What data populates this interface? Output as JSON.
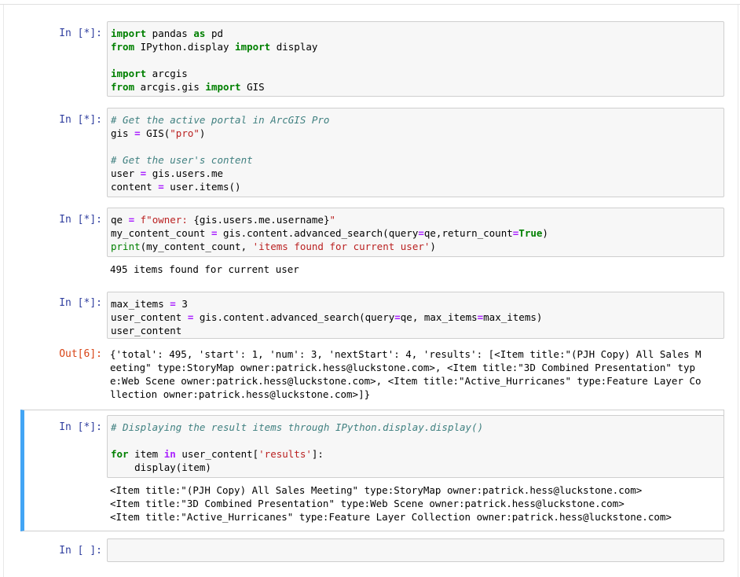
{
  "cells": [
    {
      "prompt": "In [*]:",
      "lines": [
        "import pandas as pd",
        "from IPython.display import display",
        "",
        "import arcgis",
        "from arcgis.gis import GIS"
      ]
    },
    {
      "prompt": "In [*]:",
      "lines": [
        "# Get the active portal in ArcGIS Pro",
        "gis = GIS(\"pro\")",
        "",
        "# Get the user's content",
        "user = gis.users.me",
        "content = user.items()"
      ]
    },
    {
      "prompt": "In [*]:",
      "lines": [
        "qe = f\"owner: {gis.users.me.username}\"",
        "my_content_count = gis.content.advanced_search(query=qe,return_count=True)",
        "print(my_content_count, 'items found for current user')"
      ],
      "output": [
        "495 items found for current user"
      ]
    },
    {
      "prompt": "In [*]:",
      "lines": [
        "max_items = 3",
        "user_content = gis.content.advanced_search(query=qe, max_items=max_items)",
        "user_content"
      ],
      "out_prompt": "Out[6]:",
      "output": [
        "{'total': 495, 'start': 1, 'num': 3, 'nextStart': 4, 'results': [<Item title:\"(PJH Copy) All Sales M",
        "eeting\" type:StoryMap owner:patrick.hess@luckstone.com>, <Item title:\"3D Combined Presentation\" typ",
        "e:Web Scene owner:patrick.hess@luckstone.com>, <Item title:\"Active_Hurricanes\" type:Feature Layer Co",
        "llection owner:patrick.hess@luckstone.com>]}"
      ]
    },
    {
      "prompt": "In [*]:",
      "lines": [
        "# Displaying the result items through IPython.display.display()",
        "",
        "for item in user_content['results']:",
        "    display(item)"
      ],
      "output": [
        "<Item title:\"(PJH Copy) All Sales Meeting\" type:StoryMap owner:patrick.hess@luckstone.com>",
        "<Item title:\"3D Combined Presentation\" type:Web Scene owner:patrick.hess@luckstone.com>",
        "<Item title:\"Active_Hurricanes\" type:Feature Layer Collection owner:patrick.hess@luckstone.com>"
      ]
    },
    {
      "prompt": "In [ ]:",
      "lines": []
    }
  ]
}
